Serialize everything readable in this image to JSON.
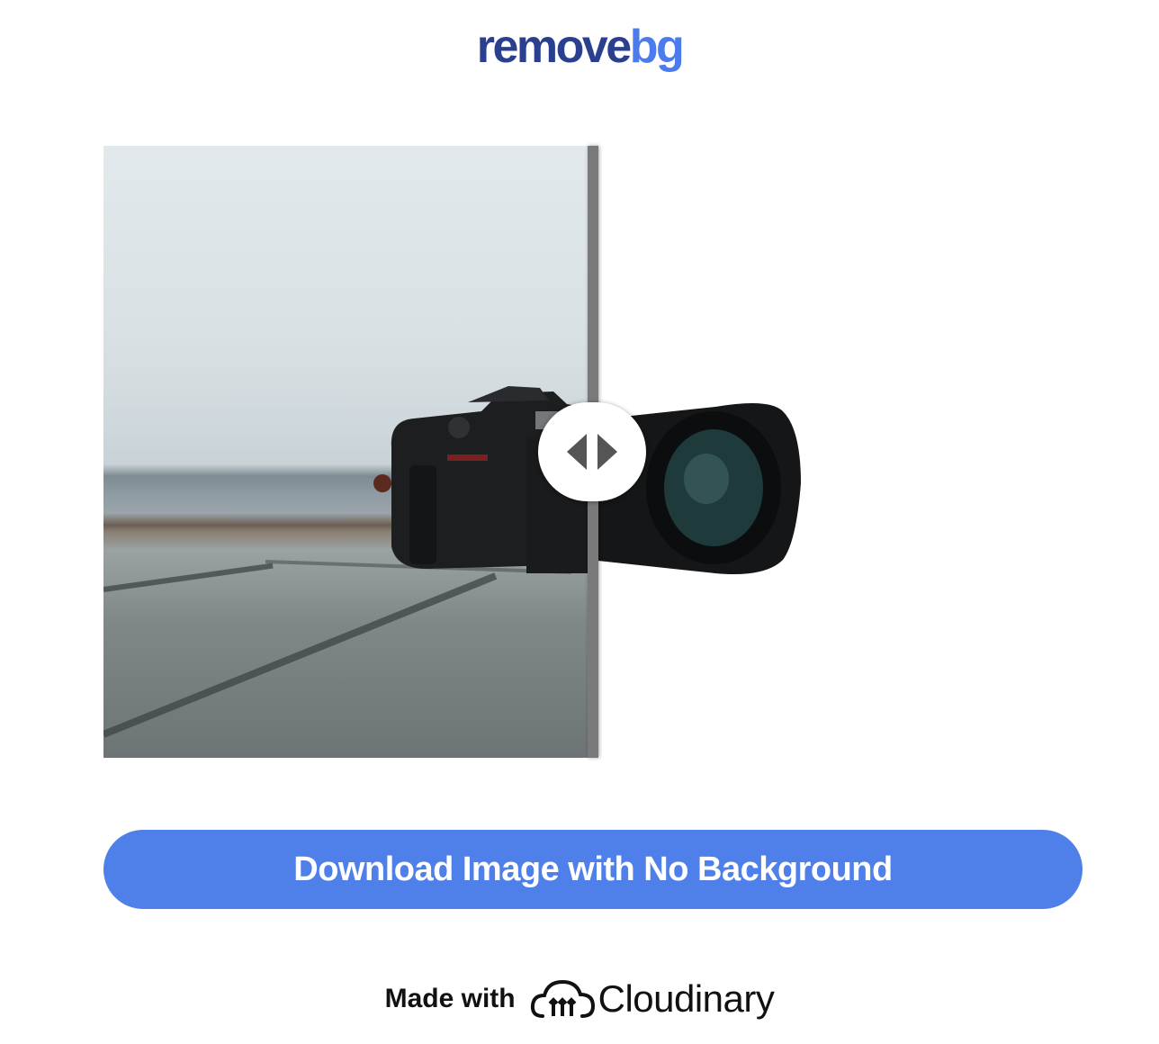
{
  "header": {
    "logo_part1": "remove",
    "logo_part2": "bg"
  },
  "comparison": {
    "slider_position": 0.5
  },
  "download_button": {
    "label": "Download Image with No Background"
  },
  "footer": {
    "made_with": "Made with",
    "brand": "Cloudinary",
    "brand_icon": "cloudinary-logo-icon"
  },
  "colors": {
    "logo_dark": "#2b3f8f",
    "logo_accent": "#4b7bec",
    "button": "#4f7fe9"
  }
}
